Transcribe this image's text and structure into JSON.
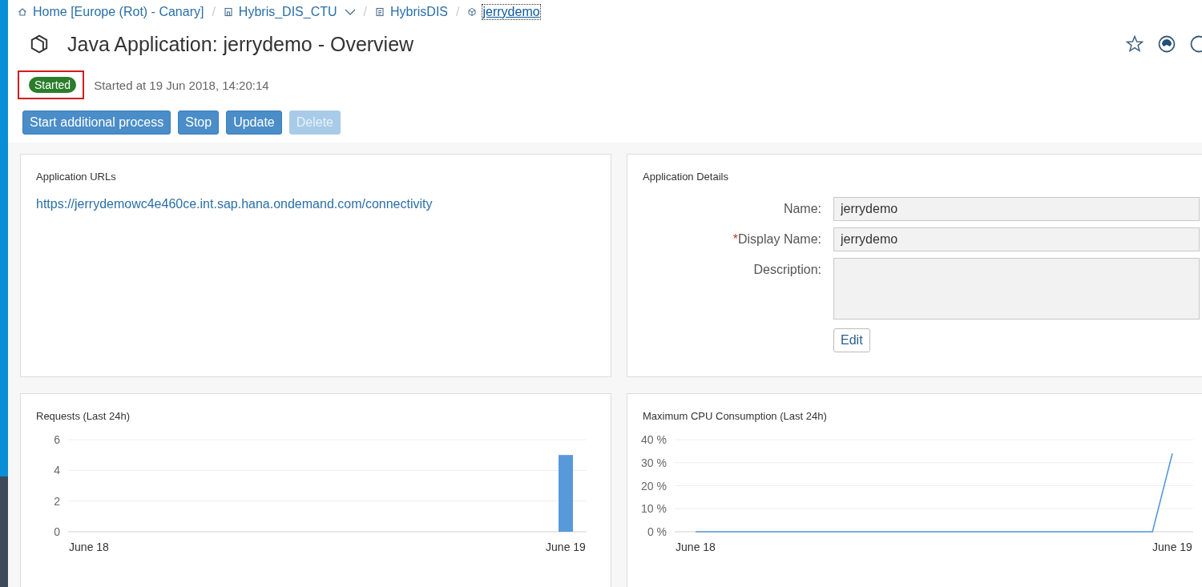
{
  "breadcrumb_separator": "/",
  "breadcrumbs": [
    {
      "kind": "home",
      "label": "Home [Europe (Rot) - Canary]",
      "has_menu": false,
      "selected": false
    },
    {
      "kind": "subaccount",
      "label": "Hybris_DIS_CTU",
      "has_menu": true,
      "selected": false
    },
    {
      "kind": "account",
      "label": "HybrisDIS",
      "has_menu": false,
      "selected": false
    },
    {
      "kind": "application",
      "label": "jerrydemo",
      "has_menu": false,
      "selected": true
    }
  ],
  "title": "Java Application: jerrydemo - Overview",
  "status": {
    "label": "Started",
    "color": "#2b7d2b",
    "highlighted": true,
    "detail": "Started at 19 Jun 2018, 14:20:14"
  },
  "actions": [
    {
      "label": "Start additional process",
      "disabled": false
    },
    {
      "label": "Stop",
      "disabled": false
    },
    {
      "label": "Update",
      "disabled": false
    },
    {
      "label": "Delete",
      "disabled": true
    }
  ],
  "urls_card": {
    "title": "Application URLs",
    "links": [
      "https://jerrydemowc4e460ce.int.sap.hana.ondemand.com/connectivity"
    ]
  },
  "details_card": {
    "title": "Application Details",
    "fields": [
      {
        "kind": "input",
        "label": "Name:",
        "required": false,
        "value": "jerrydemo"
      },
      {
        "kind": "input",
        "label": "Display Name:",
        "required": true,
        "value": "jerrydemo"
      },
      {
        "kind": "textarea",
        "label": "Description:",
        "required": false
      }
    ],
    "required_mark": "*",
    "edit_button": "Edit"
  },
  "requests_card": {
    "title": "Requests (Last 24h)",
    "chart_data": {
      "type": "bar",
      "categories": [
        "June 18",
        null,
        null,
        null,
        null,
        null,
        null,
        null,
        null,
        null,
        null,
        null,
        null,
        null,
        null,
        null,
        null,
        null,
        null,
        null,
        null,
        null,
        null,
        null,
        "June 19"
      ],
      "values": [
        0,
        0,
        0,
        0,
        0,
        0,
        0,
        0,
        0,
        0,
        0,
        0,
        0,
        0,
        0,
        0,
        0,
        0,
        0,
        0,
        0,
        0,
        0,
        0,
        5
      ],
      "grid": true,
      "ylim": [
        0,
        6
      ],
      "yticks": [
        0,
        2,
        4,
        6
      ]
    }
  },
  "cpu_card": {
    "title": "Maximum CPU Consumption (Last 24h)",
    "chart_data": {
      "type": "line",
      "categories": [
        "June 18",
        null,
        null,
        null,
        null,
        null,
        null,
        null,
        null,
        null,
        null,
        null,
        null,
        null,
        null,
        null,
        null,
        null,
        null,
        null,
        null,
        null,
        null,
        null,
        "June 19"
      ],
      "values": [
        0,
        0,
        0,
        0,
        0,
        0,
        0,
        0,
        0,
        0,
        0,
        0,
        0,
        0,
        0,
        0,
        0,
        0,
        0,
        0,
        0,
        0,
        0,
        0,
        34
      ],
      "grid": true,
      "ylim": [
        0,
        40
      ],
      "yticks": [
        {
          "value": 0,
          "label": "0 %"
        },
        {
          "value": 10,
          "label": "10 %"
        },
        {
          "value": 20,
          "label": "20 %"
        },
        {
          "value": 30,
          "label": "30 %"
        },
        {
          "value": 40,
          "label": "40 %"
        }
      ]
    }
  }
}
